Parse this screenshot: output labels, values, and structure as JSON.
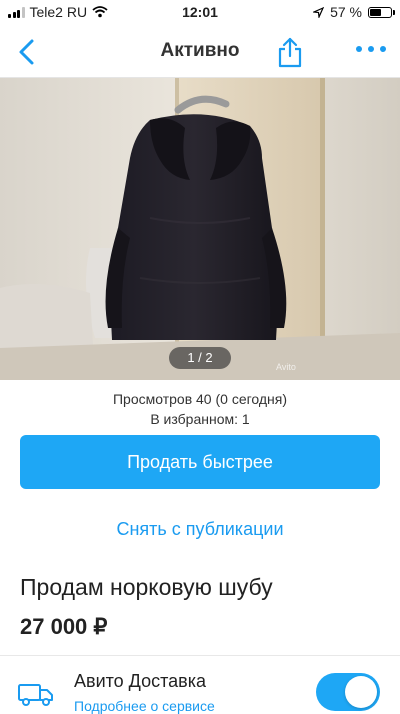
{
  "status_bar": {
    "carrier": "Tele2 RU",
    "time": "12:01",
    "battery": "57 %",
    "icons": [
      "signal-icon",
      "wifi-icon",
      "location-arrow-icon",
      "battery-icon"
    ]
  },
  "nav": {
    "title": "Активно",
    "icons": [
      "back-icon",
      "share-icon",
      "more-icon"
    ]
  },
  "gallery": {
    "counter": "1 / 2",
    "watermark": "Avito"
  },
  "stats": {
    "views": "Просмотров 40 (0 сегодня)",
    "favorites": "В избранном: 1"
  },
  "actions": {
    "sell_faster": "Продать быстрее",
    "unpublish": "Снять с публикации"
  },
  "listing": {
    "title": "Продам норковую шубу",
    "price": "27 000 ₽"
  },
  "delivery": {
    "label": "Авито Доставка",
    "link": "Подробнее о сервисе",
    "enabled": true,
    "icon": "truck-icon"
  },
  "colors": {
    "accent": "#1ea7f5",
    "link": "#1a9bf0"
  }
}
